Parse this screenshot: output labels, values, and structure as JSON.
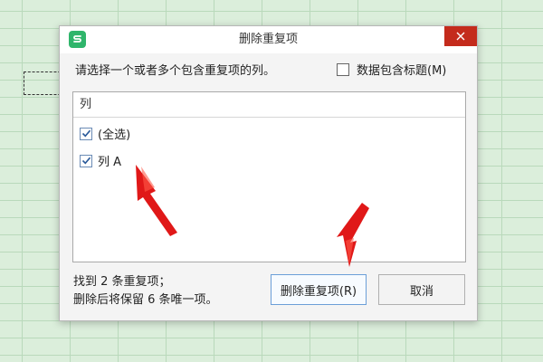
{
  "dialog": {
    "title": "删除重复项",
    "prompt": "请选择一个或者多个包含重复项的列。",
    "header_checkbox_label": "数据包含标题(M)",
    "header_checkbox_checked": false,
    "list": {
      "header": "列",
      "items": [
        {
          "label": "(全选)",
          "checked": true
        },
        {
          "label": "列 A",
          "checked": true
        }
      ]
    },
    "info_line1": "找到 2 条重复项；",
    "info_line2": "删除后将保留 6 条唯一项。",
    "remove_button": "删除重复项(R)",
    "cancel_button": "取消"
  },
  "icons": {
    "app": "wps-spreadsheet-icon",
    "close": "close-icon",
    "check": "checkmark-icon",
    "annotation": "red-arrow-icon"
  },
  "colors": {
    "app_icon": "#2fb56b",
    "close_button": "#c42b1c",
    "arrow": "#e01818",
    "checkbox_border": "#6a8bb5",
    "primary_button_border": "#6b9fd8"
  }
}
